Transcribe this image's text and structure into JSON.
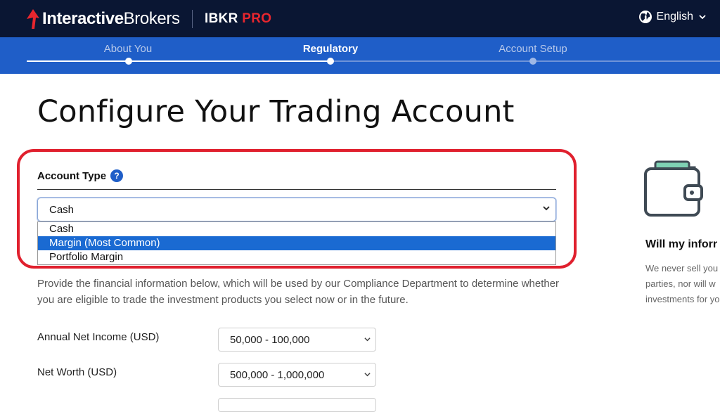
{
  "header": {
    "brand_bold": "Interactive",
    "brand_light": "Brokers",
    "product_main": "IBKR",
    "product_accent": "PRO",
    "language": "English"
  },
  "steps": [
    {
      "label": "About You",
      "state": "done"
    },
    {
      "label": "Regulatory",
      "state": "active"
    },
    {
      "label": "Account Setup",
      "state": "upcoming"
    }
  ],
  "page": {
    "title": "Configure Your Trading Account"
  },
  "account_type": {
    "label": "Account Type",
    "help": "?",
    "value": "Cash",
    "options": [
      "Cash",
      "Margin (Most Common)",
      "Portfolio Margin"
    ],
    "highlighted_option": "Margin (Most Common)"
  },
  "financial": {
    "intro": "Provide the financial information below, which will be used by our Compliance Department to determine whether you are eligible to trade the investment products you select now or in the future.",
    "fields": [
      {
        "label": "Annual Net Income (USD)",
        "value": "50,000 - 100,000"
      },
      {
        "label": "Net Worth (USD)",
        "value": "500,000 - 1,000,000"
      }
    ]
  },
  "side_panel": {
    "title": "Will my inforr",
    "lines": [
      "We never sell you",
      "parties, nor will w",
      "investments for yo"
    ]
  },
  "colors": {
    "header_bg": "#0a1633",
    "steps_bg": "#1f5ec8",
    "brand_red": "#e8262e",
    "highlight_red": "#e0202e",
    "selected_option": "#1a6ad2"
  }
}
